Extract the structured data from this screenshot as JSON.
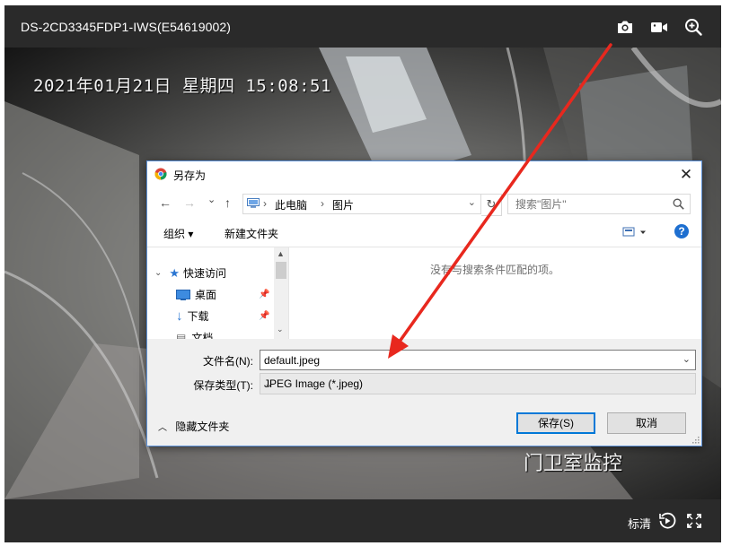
{
  "player": {
    "camera_title": "DS-2CD3345FDP1-IWS(E54619002)",
    "osd_timestamp": "2021年01月21日 星期四 15:08:51",
    "osd_label": "门卫室监控",
    "quality_label": "标清",
    "icons": [
      "camera-snapshot-icon",
      "video-record-icon",
      "zoom-in-icon",
      "playback-icon",
      "fullscreen-icon"
    ]
  },
  "dialog": {
    "title": "另存为",
    "nav": {
      "back": "←",
      "forward": "→",
      "recent": "⌄",
      "up": "↑"
    },
    "breadcrumb": [
      "此电脑",
      "图片"
    ],
    "search_placeholder": "搜索\"图片\"",
    "toolbar": {
      "organize": "组织 ▾",
      "new_folder": "新建文件夹",
      "help": "?"
    },
    "nav_pane": {
      "quick_access": "快速访问",
      "items": [
        "桌面",
        "下载",
        "文档"
      ]
    },
    "empty_message": "没有与搜索条件匹配的项。",
    "filename_label": "文件名(N):",
    "filename_value": "default.jpeg",
    "filetype_label": "保存类型(T):",
    "filetype_value": "JPEG Image (*.jpeg)",
    "hide_folders": "隐藏文件夹",
    "save_button": "保存(S)",
    "cancel_button": "取消"
  },
  "colors": {
    "annotation_arrow": "#e8281e",
    "accent": "#0078d7",
    "player_bar": "#2a2a2a"
  }
}
